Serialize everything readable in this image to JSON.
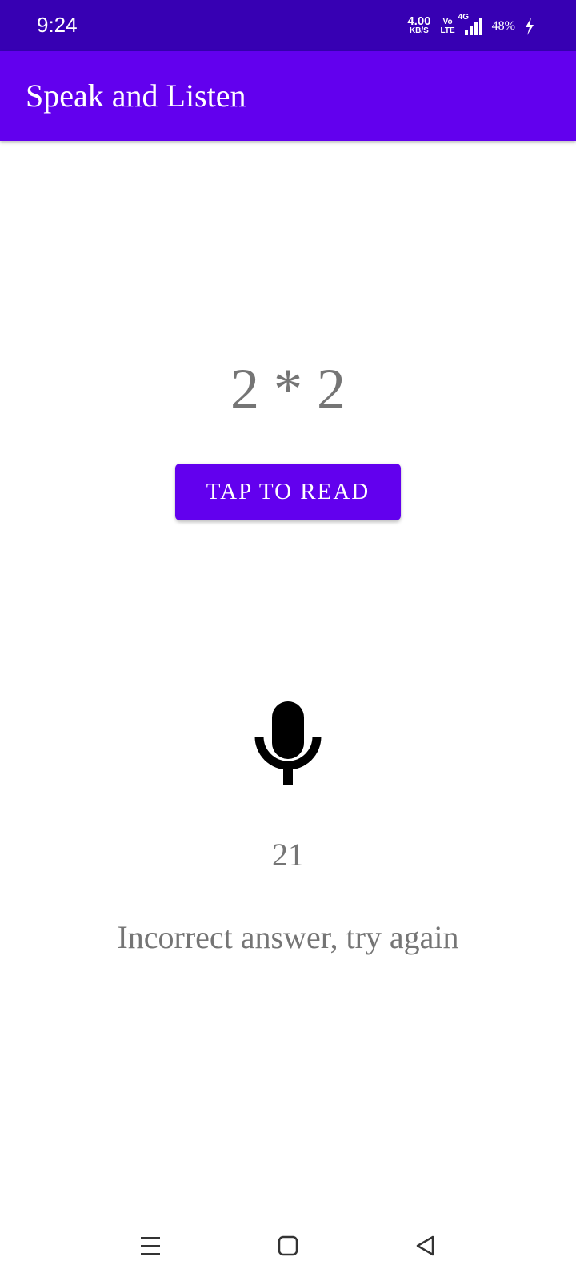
{
  "status_bar": {
    "time": "9:24",
    "net_speed_value": "4.00",
    "net_speed_unit": "KB/S",
    "volte_top": "Vo",
    "volte_bottom": "LTE",
    "network_type": "4G",
    "battery_percent": "48%",
    "icons": [
      "signal-icon",
      "charging-bolt-icon"
    ]
  },
  "app_bar": {
    "title": "Speak and Listen"
  },
  "main": {
    "question": "2 * 2",
    "tap_button_label": "TAP TO READ",
    "mic_icon": "microphone-icon",
    "spoken_answer": "21",
    "result_message": "Incorrect answer, try again"
  },
  "nav_bar": {
    "icons": [
      "menu-icon",
      "home-square-icon",
      "back-triangle-icon"
    ]
  },
  "colors": {
    "status_bar": "#3700b3",
    "primary": "#6200ee",
    "text_secondary": "#757575",
    "icon": "#000000"
  }
}
